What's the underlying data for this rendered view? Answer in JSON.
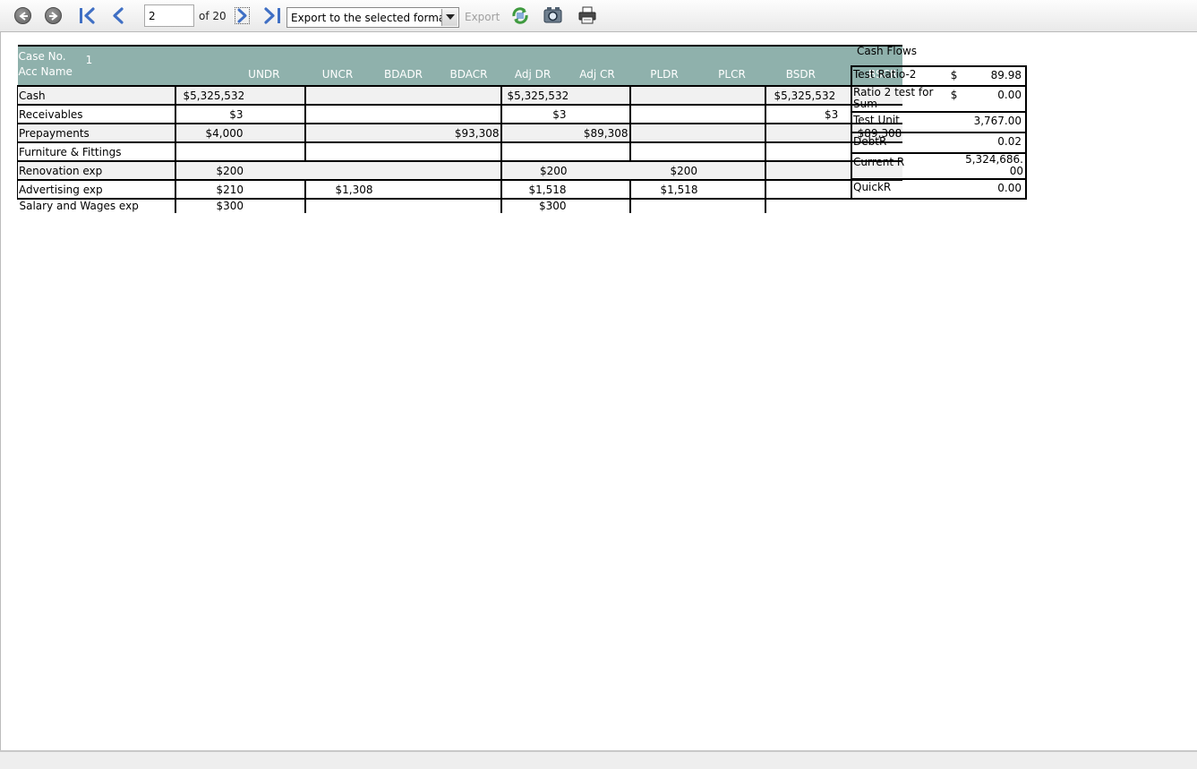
{
  "toolbar": {
    "page_value": "2",
    "page_of": "of 20",
    "export_format": "Export to the selected format",
    "export_label": "Export",
    "icons": [
      "back-icon",
      "forward-icon",
      "first-page-icon",
      "previous-page-icon",
      "next-page-icon",
      "last-page-icon",
      "refresh-icon",
      "find-icon",
      "print-icon"
    ]
  },
  "report": {
    "case_no_label": "Case No.",
    "case_no_value": "1",
    "acc_name_label": "Acc Name",
    "columns": [
      "UNDR",
      "UNCR",
      "BDADR",
      "BDACR",
      "Adj DR",
      "Adj CR",
      "PLDR",
      "PLCR",
      "BSDR",
      "BSCR"
    ],
    "rows": [
      {
        "name": "Cash",
        "undr": "$5,325,532",
        "uncr": "",
        "bdadr": "",
        "bdacr": "",
        "adjdr": "$5,325,532",
        "adjcr": "",
        "pldr": "",
        "plcr": "",
        "bsdr": "$5,325,532",
        "bscr": ""
      },
      {
        "name": "Receivables",
        "undr": "$3",
        "uncr": "",
        "bdadr": "",
        "bdacr": "",
        "adjdr": "$3",
        "adjcr": "",
        "pldr": "",
        "plcr": "",
        "bsdr": "$3",
        "bscr": ""
      },
      {
        "name": "Prepayments",
        "undr": "$4,000",
        "uncr": "",
        "bdadr": "",
        "bdacr": "$93,308",
        "adjdr": "",
        "adjcr": "$89,308",
        "pldr": "",
        "plcr": "",
        "bsdr": "",
        "bscr": "$89,308"
      },
      {
        "name": "Furniture & Fittings",
        "undr": "",
        "uncr": "",
        "bdadr": "",
        "bdacr": "",
        "adjdr": "",
        "adjcr": "",
        "pldr": "",
        "plcr": "",
        "bsdr": "",
        "bscr": ""
      },
      {
        "name": "Renovation exp",
        "undr": "$200",
        "uncr": "",
        "bdadr": "",
        "bdacr": "",
        "adjdr": "$200",
        "adjcr": "",
        "pldr": "$200",
        "plcr": "",
        "bsdr": "",
        "bscr": ""
      },
      {
        "name": "Advertising exp",
        "undr": "$210",
        "uncr": "",
        "bdadr": "$1,308",
        "bdacr": "",
        "adjdr": "$1,518",
        "adjcr": "",
        "pldr": "$1,518",
        "plcr": "",
        "bsdr": "",
        "bscr": ""
      },
      {
        "name": "Salary and Wages exp",
        "undr": "$300",
        "uncr": "",
        "bdadr": "",
        "bdacr": "",
        "adjdr": "$300",
        "adjcr": "",
        "pldr": "",
        "plcr": "",
        "bsdr": "",
        "bscr": ""
      }
    ]
  },
  "cash_flows": {
    "title": "Cash Flows",
    "rows": [
      {
        "label": "Test Ratio-2",
        "currency": "$",
        "value": "89.98"
      },
      {
        "label": "Ratio 2 test for Sum",
        "currency": "$",
        "value": "0.00"
      },
      {
        "label": "Test Unit",
        "currency": "",
        "value": "3,767.00"
      },
      {
        "label": "DebtR",
        "currency": "",
        "value": "0.02"
      },
      {
        "label": "Current R",
        "currency": "",
        "value": "5,324,686.00"
      },
      {
        "label": "QuickR",
        "currency": "",
        "value": "0.00"
      }
    ]
  },
  "colors": {
    "header_bg": "#8fb1ac",
    "header_text": "#ffffff",
    "nav_blue": "#3f6fc4",
    "row_shade": "#f1f1f1"
  }
}
